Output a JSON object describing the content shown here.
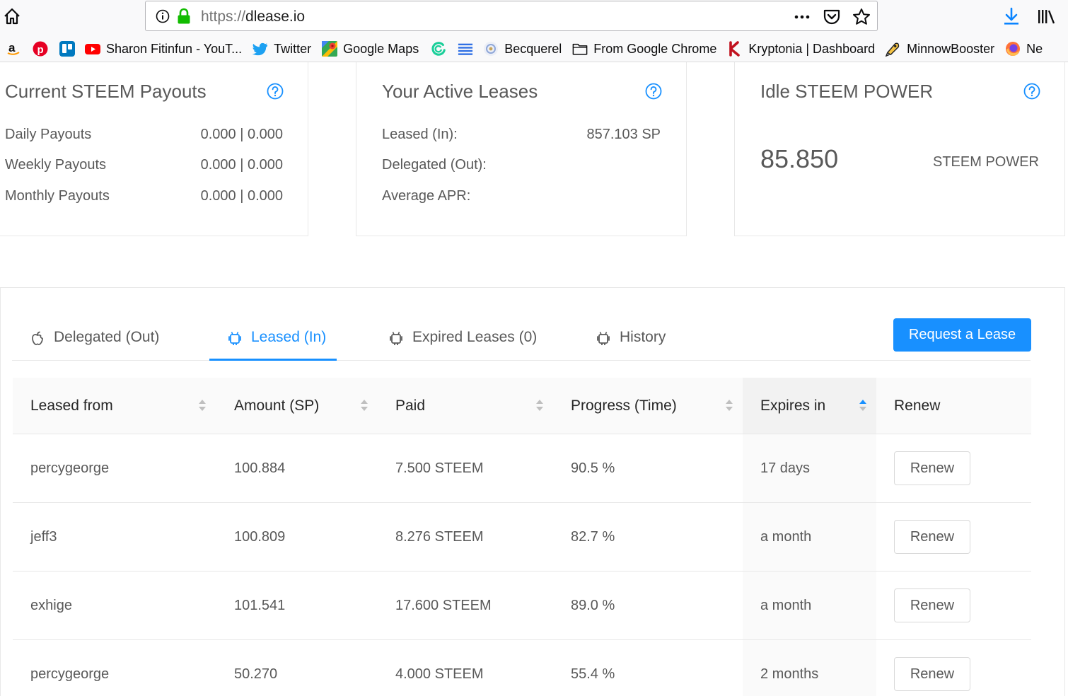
{
  "browser": {
    "url_protocol": "https://",
    "url_host": "dlease.io",
    "bookmarks": [
      {
        "label": "",
        "icon": "amazon-icon"
      },
      {
        "label": "",
        "icon": "pinterest-icon"
      },
      {
        "label": "",
        "icon": "trello-icon"
      },
      {
        "label": "Sharon Fitinfun - YouT...",
        "icon": "youtube-icon"
      },
      {
        "label": "Twitter",
        "icon": "twitter-icon"
      },
      {
        "label": "Google Maps",
        "icon": "google-maps-icon"
      },
      {
        "label": "",
        "icon": "green-swirl-icon"
      },
      {
        "label": "",
        "icon": "lines-icon"
      },
      {
        "label": "Becquerel",
        "icon": "becquerel-icon"
      },
      {
        "label": "From Google Chrome",
        "icon": "folder-icon"
      },
      {
        "label": "Kryptonia | Dashboard",
        "icon": "kryptonia-icon"
      },
      {
        "label": "MinnowBooster",
        "icon": "minnowbooster-icon"
      },
      {
        "label": "Ne",
        "icon": "firefox-icon"
      }
    ]
  },
  "cards": {
    "payouts": {
      "title": "Current STEEM Payouts",
      "rows": [
        {
          "label": "Daily Payouts",
          "value": "0.000 | 0.000"
        },
        {
          "label": "Weekly Payouts",
          "value": "0.000 | 0.000"
        },
        {
          "label": "Monthly Payouts",
          "value": "0.000 | 0.000"
        }
      ]
    },
    "active": {
      "title": "Your Active Leases",
      "rows": [
        {
          "label": "Leased (In):",
          "value": "857.103 SP"
        },
        {
          "label": "Delegated (Out):",
          "value": ""
        },
        {
          "label": "Average APR:",
          "value": ""
        }
      ]
    },
    "idle": {
      "title": "Idle STEEM POWER",
      "value": "85.850",
      "unit": "STEEM POWER"
    }
  },
  "tabs": [
    {
      "label": "Delegated (Out)",
      "icon": "apple-icon",
      "active": false
    },
    {
      "label": "Leased (In)",
      "icon": "android-icon",
      "active": true
    },
    {
      "label": "Expired Leases (0)",
      "icon": "android-icon",
      "active": false
    },
    {
      "label": "History",
      "icon": "android-icon",
      "active": false
    }
  ],
  "request_button": "Request a Lease",
  "table": {
    "columns": [
      "Leased from",
      "Amount (SP)",
      "Paid",
      "Progress (Time)",
      "Expires in",
      "Renew"
    ],
    "rows": [
      {
        "from": "percygeorge",
        "amount": "100.884",
        "paid": "7.500 STEEM",
        "progress": "90.5 %",
        "expires": "17 days",
        "renew": "Renew"
      },
      {
        "from": "jeff3",
        "amount": "100.809",
        "paid": "8.276 STEEM",
        "progress": "82.7 %",
        "expires": "a month",
        "renew": "Renew"
      },
      {
        "from": "exhige",
        "amount": "101.541",
        "paid": "17.600 STEEM",
        "progress": "89.0 %",
        "expires": "a month",
        "renew": "Renew"
      },
      {
        "from": "percygeorge",
        "amount": "50.270",
        "paid": "4.000 STEEM",
        "progress": "55.4 %",
        "expires": "2 months",
        "renew": "Renew"
      }
    ]
  },
  "colors": {
    "primary": "#1890ff",
    "text": "#595959",
    "border": "#e8e8e8"
  }
}
